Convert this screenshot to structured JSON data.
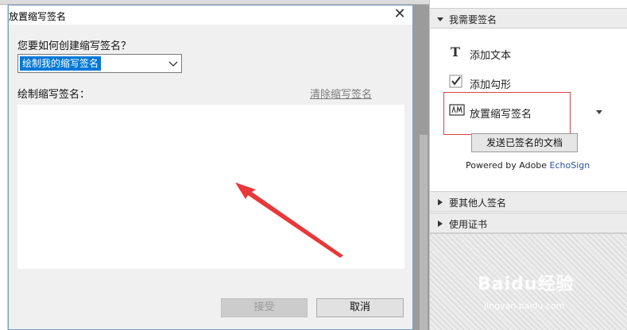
{
  "dialog": {
    "title": "放置缩写签名",
    "close_glyph": "✕",
    "question": "您要如何创建缩写签名？",
    "select_value": "绘制我的缩写签名",
    "draw_label": "绘制缩写签名：",
    "clear_link": "清除缩写签名",
    "accept_label": "接受",
    "cancel_label": "取消"
  },
  "panel": {
    "section_sign": "我需要签名",
    "add_text": "添加文本",
    "add_text_icon_glyph": "T",
    "add_check": "添加勾形",
    "place_initials": "放置缩写签名",
    "send_signed": "发送已签名的文档",
    "powered_prefix": "Powered by Adobe ",
    "powered_brand": "EchoSign",
    "section_others": "要其他人签名",
    "section_cert": "使用证书"
  },
  "watermark": {
    "text": "Baidu经验",
    "sub": "jingyan.baidu.com"
  },
  "colors": {
    "highlight": "#e04040",
    "selection": "#0078d7",
    "arrow": "#e8383a",
    "brand": "#2a4fa8"
  }
}
